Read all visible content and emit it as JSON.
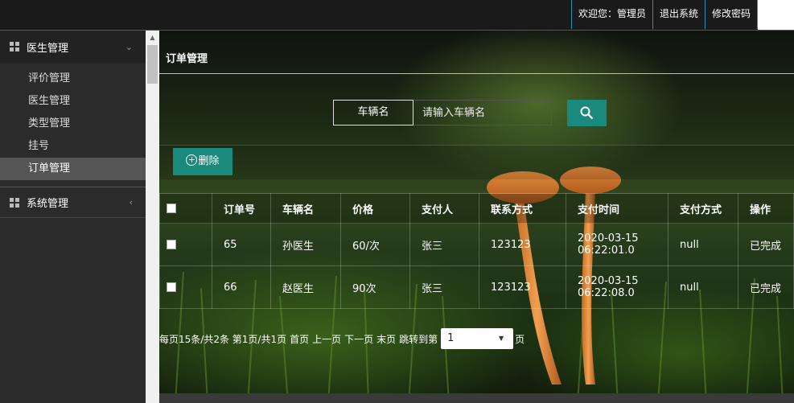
{
  "header": {
    "welcome": "欢迎您：管理员",
    "logout": "退出系统",
    "change_password": "修改密码"
  },
  "sidebar": {
    "groups": [
      {
        "label": "医生管理",
        "items": [
          {
            "label": "评价管理"
          },
          {
            "label": "医生管理"
          },
          {
            "label": "类型管理"
          },
          {
            "label": "挂号"
          },
          {
            "label": "订单管理"
          }
        ]
      },
      {
        "label": "系统管理"
      }
    ],
    "active": "订单管理"
  },
  "main": {
    "title": "订单管理",
    "search": {
      "label": "车辆名",
      "placeholder": "请输入车辆名",
      "value": ""
    },
    "delete_label": "删除",
    "table": {
      "columns": [
        "订单号",
        "车辆名",
        "价格",
        "支付人",
        "联系方式",
        "支付时间",
        "支付方式",
        "操作"
      ],
      "rows": [
        {
          "id": "65",
          "name": "孙医生",
          "price": "60/次",
          "payer": "张三",
          "contact": "123123",
          "time_date": "2020-03-15",
          "time_clock": "06:22:01.0",
          "method": "null",
          "action": "已完成"
        },
        {
          "id": "66",
          "name": "赵医生",
          "price": "90次",
          "payer": "张三",
          "contact": "123123",
          "time_date": "2020-03-15",
          "time_clock": "06:22:08.0",
          "method": "null",
          "action": "已完成"
        }
      ]
    },
    "pager": {
      "summary": "每页15条/共2条 第1页/共1页",
      "first": "首页",
      "prev": "上一页",
      "next": "下一页",
      "last": "末页",
      "jump": "跳转到第",
      "selected_page": "1",
      "suffix": "页"
    }
  },
  "colors": {
    "accent": "#1a8a7c",
    "sidebar_bg": "#2b2b2b",
    "topbar_bg": "#1a1a1a",
    "link_border": "#2d8fb8"
  },
  "icons": [
    "grid-icon",
    "chevron-down-icon",
    "chevron-left-icon",
    "search-icon",
    "plus-circle-icon"
  ]
}
